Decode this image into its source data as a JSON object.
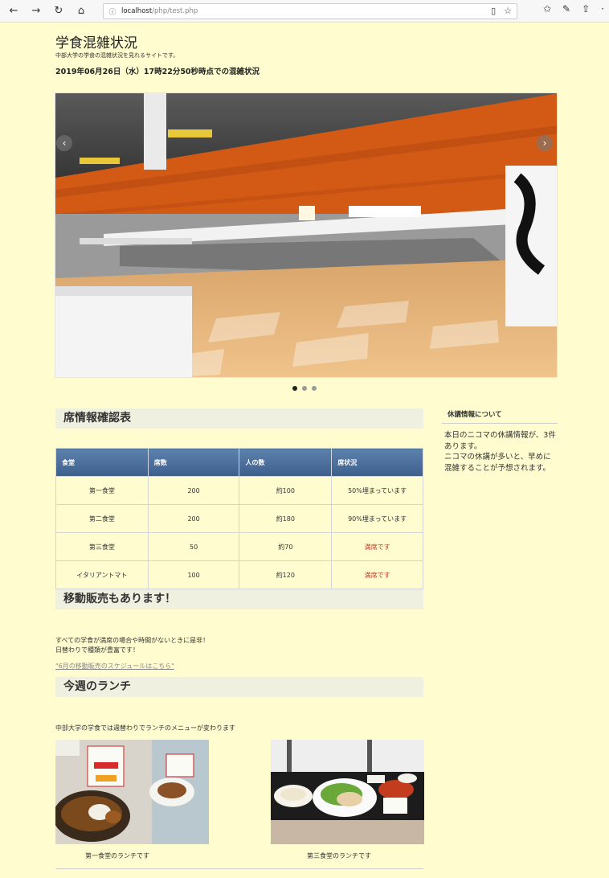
{
  "browser": {
    "url_host": "localhost",
    "url_path": "/php/test.php"
  },
  "header": {
    "title": "学食混雑状況",
    "subtitle": "中部大学の学食の混雑状況を見れるサイトです。",
    "timestamp": "2019年06月26日（水）17時22分50秒時点での混雑状況"
  },
  "carousel": {
    "slide_count": 3,
    "active_index": 0
  },
  "seat_section": {
    "heading": "席情報確認表",
    "columns": [
      "食堂",
      "席数",
      "人の数",
      "席状況"
    ],
    "rows": [
      {
        "name": "第一食堂",
        "seats": "200",
        "people": "約100",
        "status": "50%埋まっています",
        "full": false
      },
      {
        "name": "第二食堂",
        "seats": "200",
        "people": "約180",
        "status": "90%埋まっています",
        "full": false
      },
      {
        "name": "第三食堂",
        "seats": "50",
        "people": "約70",
        "status": "満席です",
        "full": true
      },
      {
        "name": "イタリアントマト",
        "seats": "100",
        "people": "約120",
        "status": "満席です",
        "full": true
      }
    ]
  },
  "sidebar": {
    "heading": "休講情報について",
    "line1": "本日のニコマの休講情報が、3件あります。",
    "line2": "ニコマの休講が多いと、早めに混雑することが予想されます。"
  },
  "mobile_section": {
    "heading": "移動販売もあります！",
    "line1": "すべての学食が満席の場合や時間がないときに是非！",
    "line2": "日替わりで種類が豊富です！",
    "link": "\"6月の移動販売のスケジュールはこちら\""
  },
  "lunch_section": {
    "heading": "今週のランチ",
    "desc": "中部大学の学食では週替わりでランチのメニューが変わります",
    "caption1": "第一食堂のランチです",
    "caption3": "第三食堂のランチです"
  },
  "colors": {
    "page_bg": "#fffdd0",
    "table_header": "#4a6d99",
    "full_status": "#c0392b"
  }
}
